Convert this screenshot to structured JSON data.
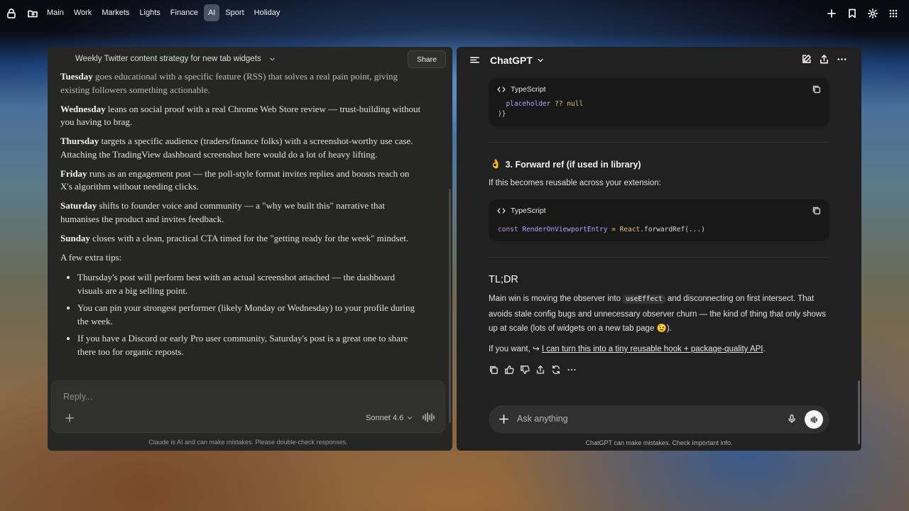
{
  "topbar": {
    "nav": [
      "Main",
      "Work",
      "Markets",
      "Lights",
      "Finance",
      "AI",
      "Sport",
      "Holiday"
    ],
    "active_index": 5
  },
  "claude": {
    "title": "Weekly Twitter content strategy for new tab widgets",
    "share_label": "Share",
    "paragraphs": [
      {
        "bold": "Tuesday",
        "text": " goes educational with a specific feature (RSS) that solves a real pain point, giving existing followers something actionable."
      },
      {
        "bold": "Wednesday",
        "text": " leans on social proof with a real Chrome Web Store review — trust-building without you having to brag."
      },
      {
        "bold": "Thursday",
        "text": " targets a specific audience (traders/finance folks) with a screenshot-worthy use case. Attaching the TradingView dashboard screenshot here would do a lot of heavy lifting."
      },
      {
        "bold": "Friday",
        "text": " runs as an engagement post — the poll-style format invites replies and boosts reach on X's algorithm without needing clicks."
      },
      {
        "bold": "Saturday",
        "text": " shifts to founder voice and community — a \"why we built this\" narrative that humanises the product and invites feedback."
      },
      {
        "bold": "Sunday",
        "text": " closes with a clean, practical CTA timed for the \"getting ready for the week\" mindset."
      }
    ],
    "tips_heading": "A few extra tips:",
    "tips": [
      "Thursday's post will perform best with an actual screenshot attached — the dashboard visuals are a big selling point.",
      "You can pin your strongest performer (likely Monday or Wednesday) to your profile during the week.",
      "If you have a Discord or early Pro user community, Saturday's post is a great one to share there too for organic reposts."
    ],
    "reply_placeholder": "Reply...",
    "model": "Sonnet 4.6",
    "footer": "Claude is AI and can make mistakes. Please double-check responses."
  },
  "chatgpt": {
    "title": "ChatGPT",
    "code1": {
      "lang": "TypeScript",
      "line1_prop": "placeholder",
      "line1_op": "??",
      "line1_val": "null",
      "line2": ")}"
    },
    "section3_emoji": "👌",
    "section3_title": "3. Forward ref (if used in library)",
    "section3_text": "If this becomes reusable across your extension:",
    "code2": {
      "lang": "TypeScript",
      "kw": "const",
      "name": "RenderOnViewportEntry",
      "eq": "=",
      "obj": "React",
      "method": "forwardRef",
      "args": "(...)"
    },
    "tldr_title": "TL;DR",
    "tldr_pre": "Main win is moving the observer into ",
    "tldr_code": "useEffect",
    "tldr_post": " and disconnecting on first intersect. That avoids stale config bugs and unnecessary observer churn — the kind of thing that only shows up at scale (lots of widgets on a new tab page 😉).",
    "offer_pre": "If you want, ↪ ",
    "offer_link": "I can turn this into a tiny reusable hook + package-quality API",
    "offer_post": ".",
    "input_placeholder": "Ask anything",
    "footer": "ChatGPT can make mistakes. Check important info."
  }
}
